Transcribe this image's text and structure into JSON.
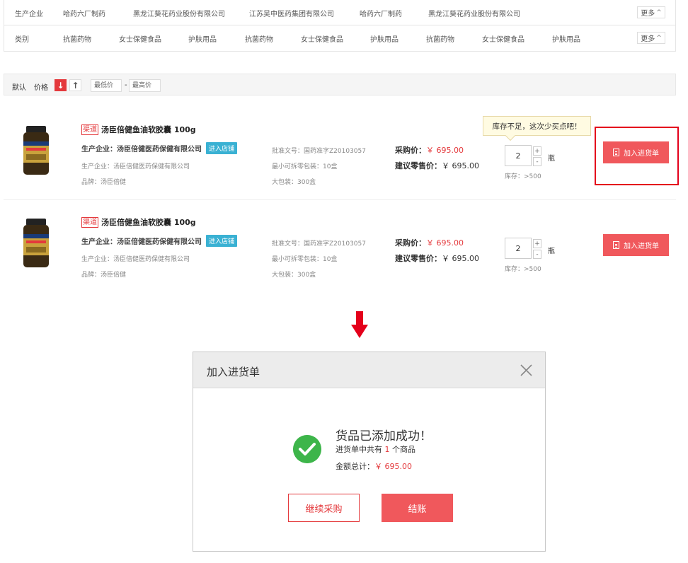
{
  "filters": {
    "row1": {
      "label": "生产企业",
      "options": [
        "哈药六厂制药",
        "黑龙江葵花药业股份有限公司",
        "江苏吴中医药集团有限公司",
        "哈药六厂制药",
        "黑龙江葵花药业股份有限公司"
      ],
      "more": "更多"
    },
    "row2": {
      "label": "类别",
      "options": [
        "抗菌药物",
        "女士保健食品",
        "护肤用品",
        "抗菌药物",
        "女士保健食品",
        "护肤用品",
        "抗菌药物",
        "女士保健食品",
        "护肤用品"
      ],
      "more": "更多"
    }
  },
  "sortbar": {
    "default": "默认",
    "price": "价格",
    "min_placeholder": "最低价",
    "dash": "-",
    "max_placeholder": "最高价"
  },
  "products": [
    {
      "tag": "渠道",
      "name": "汤臣倍健鱼油软胶囊 100g",
      "maker": "生产企业：汤臣倍健医药保健有限公司",
      "shop_btn": "进入店铺",
      "maker2": "生产企业：汤臣倍健医药保健有限公司",
      "brand": "品牌：汤臣倍健",
      "approval": "批准文号：国药准字Z20103057",
      "min_pack": "最小可拆零包装：10盒",
      "big_pack": "大包装：300盒",
      "purchase_label": "采购价：",
      "purchase_price": "￥ 695.00",
      "retail_label": "建议零售价：",
      "retail_price": "￥ 695.00",
      "qty": "2",
      "unit": "瓶",
      "stock": "库存：>500",
      "add_btn": "加入进货单",
      "tooltip": "库存不足，这次少买点吧！"
    },
    {
      "tag": "渠道",
      "name": "汤臣倍健鱼油软胶囊 100g",
      "maker": "生产企业：汤臣倍健医药保健有限公司",
      "shop_btn": "进入店铺",
      "maker2": "生产企业：汤臣倍健医药保健有限公司",
      "brand": "品牌：汤臣倍健",
      "approval": "批准文号：国药准字Z20103057",
      "min_pack": "最小可拆零包装：10盒",
      "big_pack": "大包装：300盒",
      "purchase_label": "采购价：",
      "purchase_price": "￥ 695.00",
      "retail_label": "建议零售价：",
      "retail_price": "￥ 695.00",
      "qty": "2",
      "unit": "瓶",
      "stock": "库存：>500",
      "add_btn": "加入进货单"
    }
  ],
  "stepper": {
    "plus": "+",
    "minus": "-"
  },
  "dialog": {
    "title": "加入进货单",
    "success_title": "货品已添加成功！",
    "count_prefix": "进货单中共有 ",
    "count": "1",
    "count_suffix": " 个商品",
    "total_label": "金额总计：",
    "total_value": "￥ 695.00",
    "continue_btn": "继续采购",
    "checkout_btn": "结账"
  },
  "colors": {
    "accent_red": "#e4393c",
    "button_red": "#f0585c",
    "shop_blue": "#3ab1d3",
    "success_green": "#3db54a"
  }
}
